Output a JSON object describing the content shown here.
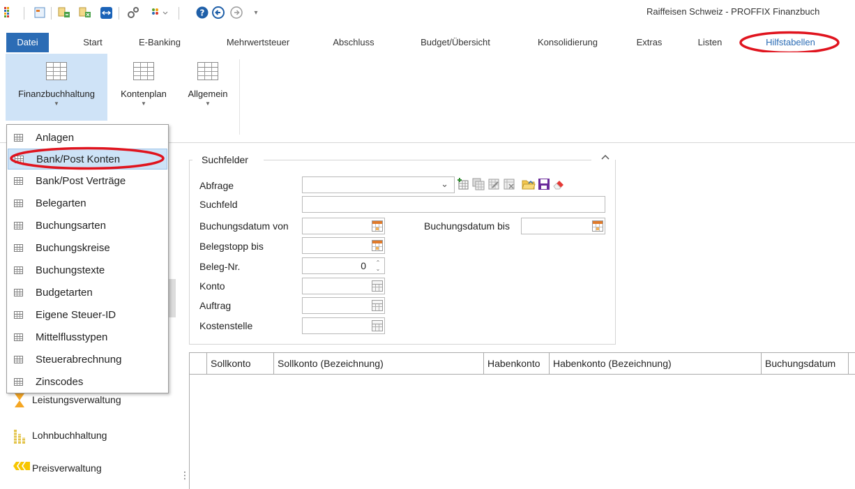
{
  "app": {
    "title": "Raiffeisen Schweiz - PROFFIX Finanzbuch"
  },
  "quick_access": {
    "icons": [
      "apps-icon",
      "app-icon",
      "export-icon",
      "import-icon",
      "teamviewer-icon",
      "tools-icon",
      "modules-icon",
      "help-icon",
      "back-icon",
      "forward-icon",
      "customize-caret-icon"
    ]
  },
  "tabs": {
    "items": [
      "Datei",
      "Start",
      "E-Banking",
      "Mehrwertsteuer",
      "Abschluss",
      "Budget/Übersicht",
      "Konsolidierung",
      "Extras",
      "Listen",
      "Hilfstabellen"
    ],
    "active": "Hilfstabellen"
  },
  "ribbon": {
    "buttons": [
      "Finanzbuchhaltung",
      "Kontenplan",
      "Allgemein"
    ]
  },
  "dropdown": {
    "items": [
      "Anlagen",
      "Bank/Post Konten",
      "Bank/Post Verträge",
      "Belegarten",
      "Buchungsarten",
      "Buchungskreise",
      "Buchungstexte",
      "Budgetarten",
      "Eigene Steuer-ID",
      "Mittelflusstypen",
      "Steuerabrechnung",
      "Zinscodes"
    ],
    "highlighted": "Bank/Post Konten"
  },
  "nav": {
    "items": [
      "Leistungsverwaltung",
      "Lohnbuchhaltung",
      "Preisverwaltung"
    ]
  },
  "search": {
    "title": "Suchfelder",
    "labels": {
      "abfrage": "Abfrage",
      "suchfeld": "Suchfeld",
      "buchungsdatum_von": "Buchungsdatum von",
      "buchungsdatum_bis": "Buchungsdatum bis",
      "belegstopp_bis": "Belegstopp bis",
      "beleg_nr": "Beleg-Nr.",
      "konto": "Konto",
      "auftrag": "Auftrag",
      "kostenstelle": "Kostenstelle"
    },
    "values": {
      "abfrage": "",
      "suchfeld": "",
      "buchungsdatum_von": "",
      "buchungsdatum_bis": "",
      "belegstopp_bis": "",
      "beleg_nr": "0",
      "konto": "",
      "auftrag": "",
      "kostenstelle": ""
    }
  },
  "grid": {
    "columns": [
      "Sollkonto",
      "Sollkonto (Bezeichnung)",
      "Habenkonto",
      "Habenkonto (Bezeichnung)",
      "Buchungsdatum"
    ],
    "rows": []
  },
  "colors": {
    "accent": "#2b6cb5",
    "highlight_ring": "#e0141e",
    "selection": "#cde3f7"
  }
}
